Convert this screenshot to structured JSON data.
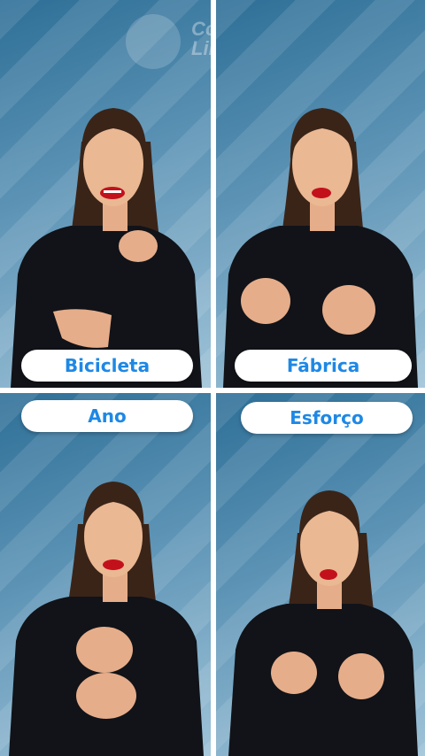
{
  "brand": {
    "name_line1": "Conecte",
    "name_line2": "Libras"
  },
  "panels": [
    {
      "label": "Bicicleta"
    },
    {
      "label": "Fábrica"
    },
    {
      "label": "Ano"
    },
    {
      "label": "Esforço"
    }
  ],
  "colors": {
    "label_text": "#1e88e5",
    "background_top": "#2e6f97",
    "background_bottom": "#9fc3d8"
  }
}
